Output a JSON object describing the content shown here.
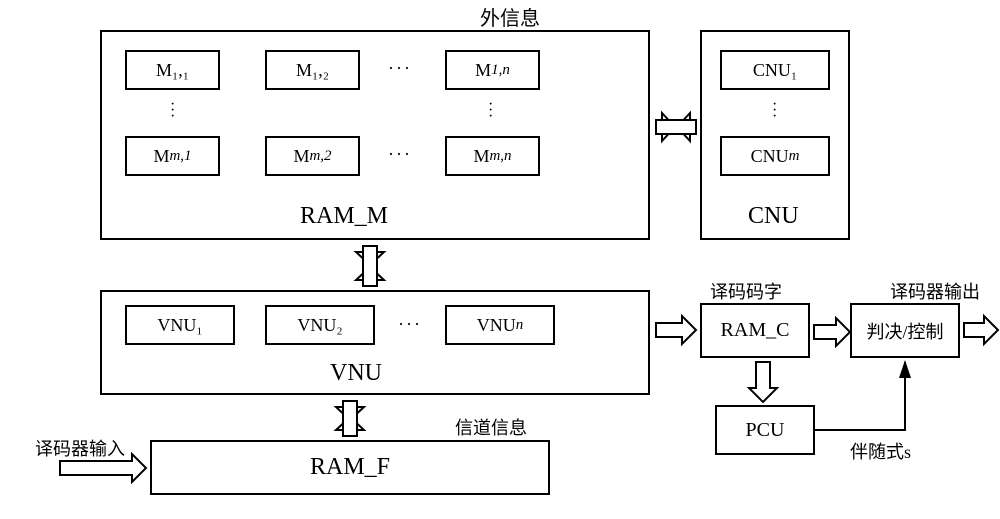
{
  "labels": {
    "outer_info": "外信息",
    "ram_m": "RAM_M",
    "cnu": "CNU",
    "vnu": "VNU",
    "ram_c": "RAM_C",
    "pcu": "PCU",
    "judge": "判决/控制",
    "ram_f": "RAM_F",
    "channel_info": "信道信息",
    "code_word": "译码码字",
    "decoder_out": "译码器输出",
    "decoder_in": "译码器输入",
    "syndrome": "伴随式s",
    "ellipsis": "···",
    "vdot": "·"
  },
  "cells": {
    "m11": "M₁,₁",
    "m12": "M₁,₂",
    "m1n_pre": "M",
    "m1n_sub": "1,n",
    "mm1_pre": "M",
    "mm1_sub": "m,1",
    "mm2_pre": "M",
    "mm2_sub": "m,2",
    "mmn_pre": "M",
    "mmn_sub": "m,n",
    "cnu1": "CNU₁",
    "cnum_pre": "CNU",
    "cnum_sub": "m",
    "vnu1": "VNU₁",
    "vnu2": "VNU₂",
    "vnun_pre": "VNU",
    "vnun_sub": "n"
  }
}
